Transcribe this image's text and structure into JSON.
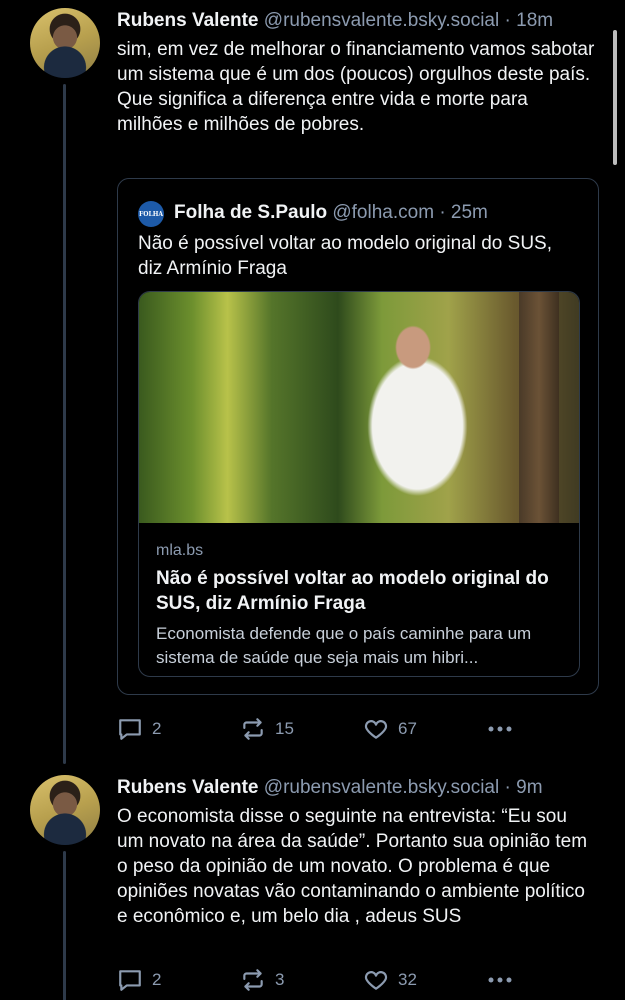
{
  "posts": [
    {
      "author_name": "Rubens Valente",
      "handle": "@rubensvalente.bsky.social",
      "separator": "·",
      "time": "18m",
      "text": "sim, em vez de melhorar o financiamento vamos sabotar um sistema que é um dos (poucos) orgulhos deste país. Que significa a diferença entre vida e morte para milhões e milhões de pobres.",
      "quote": {
        "logo_text": "FOLHA",
        "author_name": "Folha de S.Paulo",
        "handle": "@folha.com",
        "separator": "·",
        "time": "25m",
        "text": "Não é possível voltar ao modelo original do SUS, diz Armínio Fraga",
        "embed": {
          "domain": "mla.bs",
          "title": "Não é possível voltar ao modelo original do SUS, diz Armínio Fraga",
          "description": "Economista defende que o país caminhe para um sistema de saúde que seja mais um hibri..."
        }
      },
      "actions": {
        "replies": "2",
        "reposts": "15",
        "likes": "67"
      }
    },
    {
      "author_name": "Rubens Valente",
      "handle": "@rubensvalente.bsky.social",
      "separator": "·",
      "time": "9m",
      "text": "O economista disse o seguinte na entrevista: “Eu sou um novato na área da saúde”. Portanto sua opinião tem o peso da opinião de um novato. O problema é que opiniões novatas vão contaminando o ambiente político e econômico e, um belo dia , adeus SUS",
      "actions": {
        "replies": "2",
        "reposts": "3",
        "likes": "32"
      }
    }
  ],
  "icons": {
    "reply": "speech-bubble-icon",
    "repost": "repost-arrows-icon",
    "like": "heart-outline-icon",
    "more": "ellipsis-icon"
  },
  "colors": {
    "background": "#000000",
    "text": "#f1f3f5",
    "muted": "#8c9bb0",
    "border": "#2e3a4a",
    "logo": "#1d5aa8"
  }
}
